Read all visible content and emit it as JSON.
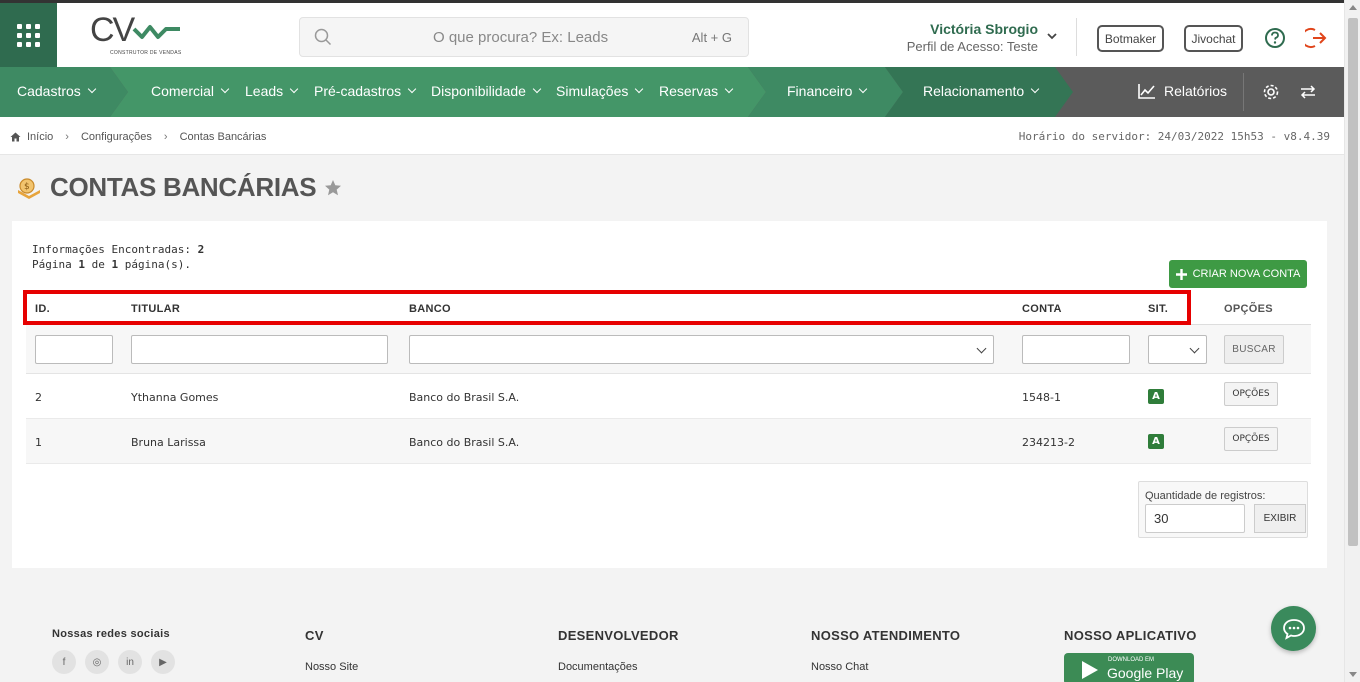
{
  "header": {
    "logo_text": "CV",
    "logo_sub": "CONSTRUTOR DE VENDAS",
    "search_placeholder": "O que procura? Ex: Leads",
    "search_shortcut": "Alt + G",
    "user_name": "Victória Sbrogio",
    "user_profile": "Perfil de Acesso: Teste",
    "botmaker_label": "Botmaker",
    "jivochat_label": "Jivochat"
  },
  "nav": {
    "items": [
      "Cadastros",
      "Comercial",
      "Leads",
      "Pré-cadastros",
      "Disponibilidade",
      "Simulações",
      "Reservas",
      "Financeiro",
      "Relacionamento"
    ],
    "reports_label": "Relatórios"
  },
  "breadcrumb": {
    "items": [
      "Início",
      "Configurações",
      "Contas Bancárias"
    ],
    "server_time": "Horário do servidor: 24/03/2022 15h53 - v8.4.39"
  },
  "page": {
    "title": "CONTAS BANCÁRIAS"
  },
  "results": {
    "found_label": "Informações Encontradas:",
    "found_count": "2",
    "page_prefix": "Página",
    "page_num": "1",
    "page_of": "de",
    "page_total": "1",
    "page_suffix": "página(s).",
    "create_label": "CRIAR NOVA CONTA"
  },
  "table": {
    "headers": [
      "ID.",
      "TITULAR",
      "BANCO",
      "CONTA",
      "SIT.",
      "OPÇÕES"
    ],
    "search_label": "BUSCAR",
    "rows": [
      {
        "id": "2",
        "titular": "Ythanna Gomes",
        "banco": "Banco do Brasil S.A.",
        "conta": "1548-1",
        "sit": "A",
        "options": "OPÇÕES"
      },
      {
        "id": "1",
        "titular": "Bruna Larissa",
        "banco": "Banco do Brasil S.A.",
        "conta": "234213-2",
        "sit": "A",
        "options": "OPÇÕES"
      }
    ]
  },
  "records": {
    "label": "Quantidade de registros:",
    "value": "30",
    "button": "EXIBIR"
  },
  "footer": {
    "social_title": "Nossas redes sociais",
    "cv_title": "CV",
    "cv_link": "Nosso Site",
    "dev_title": "DESENVOLVEDOR",
    "dev_link": "Documentações",
    "support_title": "NOSSO ATENDIMENTO",
    "support_link": "Nosso Chat",
    "app_title": "NOSSO APLICATIVO",
    "gplay_small": "DOWNLOAD EM",
    "gplay_big": "Google Play"
  },
  "colors": {
    "brand_green": "#2f6b4f",
    "nav_green": "#3e8a63",
    "create_green": "#3e9a44",
    "highlight_red": "#e60000"
  }
}
